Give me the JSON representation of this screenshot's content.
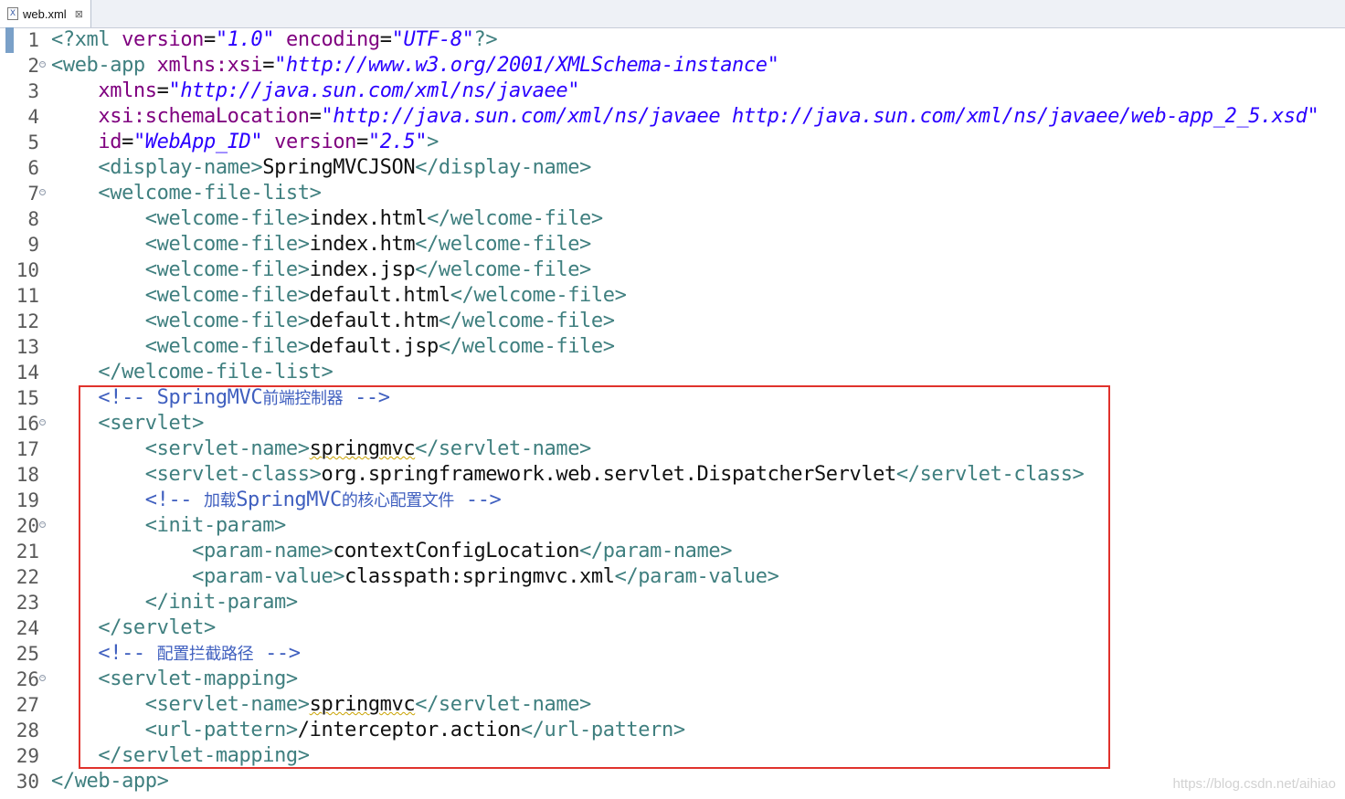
{
  "tab": {
    "title": "web.xml",
    "close_glyph": "⊠",
    "file_icon": "X"
  },
  "lines": [
    [
      [
        "t",
        "<?"
      ],
      [
        "t",
        "xml "
      ],
      [
        "a",
        "version"
      ],
      [
        "x",
        "="
      ],
      [
        "v",
        "\"1.0\""
      ],
      [
        "x",
        " "
      ],
      [
        "a",
        "encoding"
      ],
      [
        "x",
        "="
      ],
      [
        "v",
        "\"UTF-8\""
      ],
      [
        "t",
        "?>"
      ]
    ],
    [
      [
        "t",
        "<web-app "
      ],
      [
        "a",
        "xmlns:xsi"
      ],
      [
        "x",
        "="
      ],
      [
        "v",
        "\"http://www.w3.org/2001/XMLSchema-instance\""
      ]
    ],
    [
      [
        "x",
        "    "
      ],
      [
        "a",
        "xmlns"
      ],
      [
        "x",
        "="
      ],
      [
        "v",
        "\"http://java.sun.com/xml/ns/javaee\""
      ]
    ],
    [
      [
        "x",
        "    "
      ],
      [
        "a",
        "xsi:schemaLocation"
      ],
      [
        "x",
        "="
      ],
      [
        "v",
        "\"http://java.sun.com/xml/ns/javaee http://java.sun.com/xml/ns/javaee/web-app_2_5.xsd\""
      ]
    ],
    [
      [
        "x",
        "    "
      ],
      [
        "a",
        "id"
      ],
      [
        "x",
        "="
      ],
      [
        "v",
        "\"WebApp_ID\""
      ],
      [
        "x",
        " "
      ],
      [
        "a",
        "version"
      ],
      [
        "x",
        "="
      ],
      [
        "v",
        "\"2.5\""
      ],
      [
        "t",
        ">"
      ]
    ],
    [
      [
        "x",
        "    "
      ],
      [
        "t",
        "<display-name>"
      ],
      [
        "x",
        "SpringMVCJSON"
      ],
      [
        "t",
        "</display-name>"
      ]
    ],
    [
      [
        "x",
        "    "
      ],
      [
        "t",
        "<welcome-file-list>"
      ]
    ],
    [
      [
        "x",
        "        "
      ],
      [
        "t",
        "<welcome-file>"
      ],
      [
        "x",
        "index.html"
      ],
      [
        "t",
        "</welcome-file>"
      ]
    ],
    [
      [
        "x",
        "        "
      ],
      [
        "t",
        "<welcome-file>"
      ],
      [
        "x",
        "index.htm"
      ],
      [
        "t",
        "</welcome-file>"
      ]
    ],
    [
      [
        "x",
        "        "
      ],
      [
        "t",
        "<welcome-file>"
      ],
      [
        "x",
        "index.jsp"
      ],
      [
        "t",
        "</welcome-file>"
      ]
    ],
    [
      [
        "x",
        "        "
      ],
      [
        "t",
        "<welcome-file>"
      ],
      [
        "x",
        "default.html"
      ],
      [
        "t",
        "</welcome-file>"
      ]
    ],
    [
      [
        "x",
        "        "
      ],
      [
        "t",
        "<welcome-file>"
      ],
      [
        "x",
        "default.htm"
      ],
      [
        "t",
        "</welcome-file>"
      ]
    ],
    [
      [
        "x",
        "        "
      ],
      [
        "t",
        "<welcome-file>"
      ],
      [
        "x",
        "default.jsp"
      ],
      [
        "t",
        "</welcome-file>"
      ]
    ],
    [
      [
        "x",
        "    "
      ],
      [
        "t",
        "</welcome-file-list>"
      ]
    ],
    [
      [
        "x",
        "    "
      ],
      [
        "c",
        "<!-- SpringMVC"
      ],
      [
        "cj",
        "前端控制器"
      ],
      [
        "c",
        " -->"
      ]
    ],
    [
      [
        "x",
        "    "
      ],
      [
        "t",
        "<servlet>"
      ]
    ],
    [
      [
        "x",
        "        "
      ],
      [
        "t",
        "<servlet-name>"
      ],
      [
        "sq",
        "springmvc"
      ],
      [
        "t",
        "</servlet-name>"
      ]
    ],
    [
      [
        "x",
        "        "
      ],
      [
        "t",
        "<servlet-class>"
      ],
      [
        "x",
        "org.springframework.web.servlet.DispatcherServlet"
      ],
      [
        "t",
        "</servlet-class>"
      ]
    ],
    [
      [
        "x",
        "        "
      ],
      [
        "c",
        "<!-- "
      ],
      [
        "cj",
        "加载"
      ],
      [
        "c",
        "SpringMVC"
      ],
      [
        "cj",
        "的核心配置文件"
      ],
      [
        "c",
        " -->"
      ]
    ],
    [
      [
        "x",
        "        "
      ],
      [
        "t",
        "<init-param>"
      ]
    ],
    [
      [
        "x",
        "            "
      ],
      [
        "t",
        "<param-name>"
      ],
      [
        "x",
        "contextConfigLocation"
      ],
      [
        "t",
        "</param-name>"
      ]
    ],
    [
      [
        "x",
        "            "
      ],
      [
        "t",
        "<param-value>"
      ],
      [
        "x",
        "classpath:springmvc.xml"
      ],
      [
        "t",
        "</param-value>"
      ]
    ],
    [
      [
        "x",
        "        "
      ],
      [
        "t",
        "</init-param>"
      ]
    ],
    [
      [
        "x",
        "    "
      ],
      [
        "t",
        "</servlet>"
      ]
    ],
    [
      [
        "x",
        "    "
      ],
      [
        "c",
        "<!-- "
      ],
      [
        "cj",
        "配置拦截路径"
      ],
      [
        "c",
        " -->"
      ]
    ],
    [
      [
        "x",
        "    "
      ],
      [
        "t",
        "<servlet-mapping>"
      ]
    ],
    [
      [
        "x",
        "        "
      ],
      [
        "t",
        "<servlet-name>"
      ],
      [
        "sq",
        "springmvc"
      ],
      [
        "t",
        "</servlet-name>"
      ]
    ],
    [
      [
        "x",
        "        "
      ],
      [
        "t",
        "<url-pattern>"
      ],
      [
        "x",
        "/interceptor.action"
      ],
      [
        "t",
        "</url-pattern>"
      ]
    ],
    [
      [
        "x",
        "    "
      ],
      [
        "t",
        "</servlet-mapping>"
      ]
    ],
    [
      [
        "t",
        "</web-app>"
      ]
    ]
  ],
  "line_numbers": [
    "1",
    "2",
    "3",
    "4",
    "5",
    "6",
    "7",
    "8",
    "9",
    "10",
    "11",
    "12",
    "13",
    "14",
    "15",
    "16",
    "17",
    "18",
    "19",
    "20",
    "21",
    "22",
    "23",
    "24",
    "25",
    "26",
    "27",
    "28",
    "29",
    "30"
  ],
  "folds": [
    2,
    7,
    16,
    20,
    26
  ],
  "watermark": "https://blog.csdn.net/aihiao",
  "colors": {
    "tag": "#3f7f7f",
    "attribute": "#7f007f",
    "value": "#2a00ff",
    "comment": "#3f5fbf",
    "highlight_box": "#e0322c"
  }
}
